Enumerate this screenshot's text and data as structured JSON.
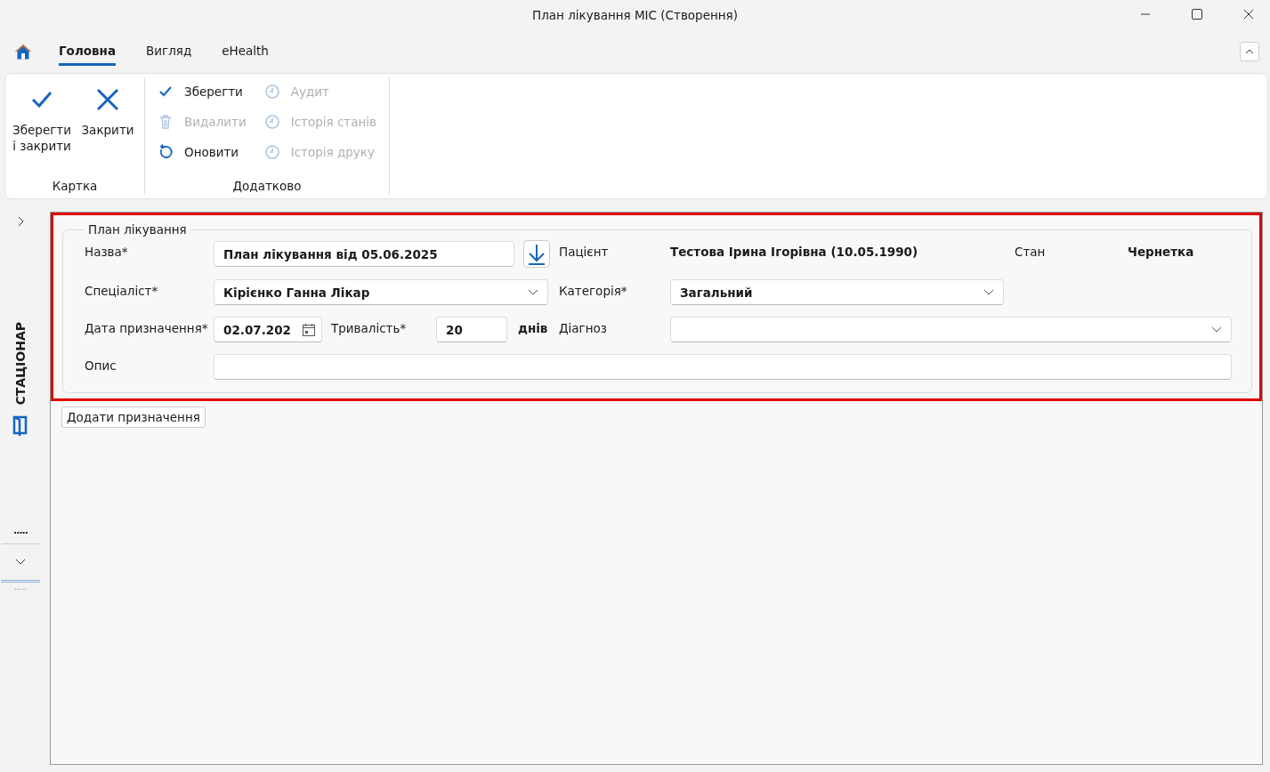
{
  "window": {
    "title": "План лікування МІС (Створення)"
  },
  "tabs": [
    {
      "label": "Головна",
      "selected": true
    },
    {
      "label": "Вигляд",
      "selected": false
    },
    {
      "label": "eHealth",
      "selected": false
    }
  ],
  "ribbon": {
    "groups": [
      {
        "label": "Картка",
        "large_buttons": [
          {
            "label": "Зберегти і закрити",
            "kind": "check"
          },
          {
            "label": "Закрити",
            "kind": "close"
          }
        ]
      },
      {
        "label": "Додатково",
        "columns": [
          [
            {
              "label": "Зберегти",
              "kind": "check",
              "disabled": false
            },
            {
              "label": "Видалити",
              "kind": "trash",
              "disabled": true
            },
            {
              "label": "Оновити",
              "kind": "refresh",
              "disabled": false
            }
          ],
          [
            {
              "label": "Аудит",
              "kind": "clock",
              "disabled": true
            },
            {
              "label": "Історія станів",
              "kind": "clock",
              "disabled": true
            },
            {
              "label": "Історія друку",
              "kind": "clock",
              "disabled": true
            }
          ]
        ]
      }
    ]
  },
  "side_rail": {
    "section": "СТАЦІОНАР",
    "more": ".....",
    "footer": "....."
  },
  "form": {
    "legend": "План лікування",
    "name": {
      "label": "Назва*",
      "value": "План лікування від 05.06.2025"
    },
    "patient": {
      "label": "Пацієнт",
      "value": "Тестова Ірина Ігорівна (10.05.1990)"
    },
    "state": {
      "label": "Стан",
      "value": "Чернетка"
    },
    "specialist": {
      "label": "Спеціаліст*",
      "value": "Кірієнко Ганна Лікар"
    },
    "category": {
      "label": "Категорія*",
      "value": "Загальний"
    },
    "date": {
      "label": "Дата призначення*",
      "value": "02.07.202"
    },
    "duration": {
      "label": "Тривалість*",
      "value": "20",
      "unit": "днів"
    },
    "diagnosis": {
      "label": "Діагноз"
    },
    "description": {
      "label": "Опис"
    }
  },
  "add_button": "Додати призначення"
}
